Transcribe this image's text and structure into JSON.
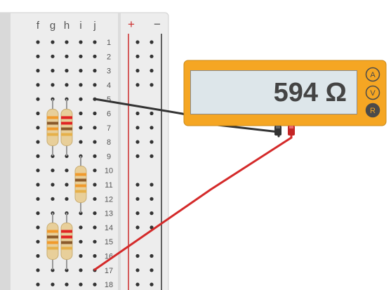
{
  "breadboard": {
    "column_labels": [
      "f",
      "g",
      "h",
      "i",
      "j"
    ],
    "rail_labels": [
      "+",
      "−"
    ],
    "row_numbers": [
      "1",
      "2",
      "3",
      "4",
      "5",
      "6",
      "7",
      "8",
      "9",
      "10",
      "11",
      "12",
      "13",
      "14",
      "15",
      "16",
      "17",
      "18"
    ]
  },
  "multimeter": {
    "reading": "594 Ω",
    "mode_buttons": [
      "A",
      "V",
      "R"
    ],
    "selected_mode": "R"
  },
  "colors": {
    "board": "#ededed",
    "board_edge": "#d0d0d0",
    "hole": "#333333",
    "rail_plus": "#cc2b2b",
    "rail_minus": "#333333",
    "meter_body": "#f5a623",
    "meter_display": "#dde6ea",
    "wire_black": "#333333",
    "wire_red": "#d42a2a",
    "resistor_body": "#e8cf9a"
  }
}
